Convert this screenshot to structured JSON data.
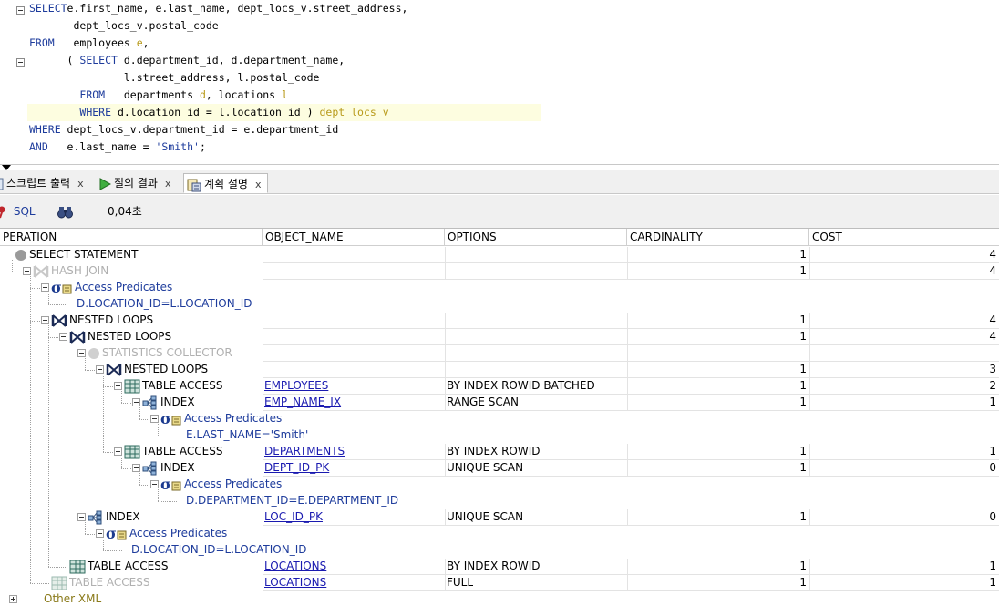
{
  "editor": {
    "lines": [
      {
        "segments": [
          [
            "kw",
            "SELECT"
          ],
          [
            "",
            "e.first_name, e.last_name, dept_locs_v.street_address,"
          ]
        ]
      },
      {
        "segments": [
          [
            "",
            "       dept_locs_v.postal_code"
          ]
        ]
      },
      {
        "segments": [
          [
            "kw",
            "FROM"
          ],
          [
            "",
            "   employees "
          ],
          [
            "al",
            "e"
          ],
          [
            "",
            ","
          ]
        ]
      },
      {
        "segments": [
          [
            "",
            "      ( "
          ],
          [
            "kw",
            "SELECT"
          ],
          [
            "",
            " d.department_id, d.department_name,"
          ]
        ]
      },
      {
        "segments": [
          [
            "",
            "               l.street_address, l.postal_code"
          ]
        ]
      },
      {
        "segments": [
          [
            "",
            "        "
          ],
          [
            "kw",
            "FROM"
          ],
          [
            "",
            "   departments "
          ],
          [
            "al",
            "d"
          ],
          [
            "",
            ", locations "
          ],
          [
            "al",
            "l"
          ]
        ]
      },
      {
        "segments": [
          [
            "",
            "        "
          ],
          [
            "kw",
            "WHERE"
          ],
          [
            "",
            " d.location_id = l.location_id ) "
          ],
          [
            "al",
            "dept_locs_v"
          ]
        ]
      },
      {
        "segments": [
          [
            "kw",
            "WHERE"
          ],
          [
            "",
            " dept_locs_v.department_id = e.department_id"
          ]
        ]
      },
      {
        "segments": [
          [
            "kw",
            "AND"
          ],
          [
            "",
            "   e.last_name = "
          ],
          [
            "str",
            "'Smith'"
          ],
          [
            "",
            ";"
          ]
        ]
      }
    ]
  },
  "tabs": [
    {
      "label": "스크립트 출력",
      "close": "x"
    },
    {
      "label": "질의 결과",
      "close": "x"
    },
    {
      "label": "계획 설명",
      "close": "x"
    }
  ],
  "toolbar": {
    "sql_label": "SQL",
    "elapsed": "0,04초"
  },
  "grid": {
    "columns": [
      "PERATION",
      "OBJECT_NAME",
      "OPTIONS",
      "CARDINALITY",
      "COST"
    ],
    "rows": [
      {
        "operation": "SELECT STATEMENT",
        "kind": "stmt",
        "style": "",
        "object": "",
        "options": "",
        "cardinality": "1",
        "cost": "4"
      },
      {
        "operation": "HASH JOIN",
        "kind": "join",
        "style": "dim",
        "object": "",
        "options": "",
        "cardinality": "1",
        "cost": "4"
      },
      {
        "operation": "Access Predicates",
        "kind": "filter",
        "style": "pred"
      },
      {
        "operation": "D.LOCATION_ID=L.LOCATION_ID",
        "kind": "none",
        "style": "pred"
      },
      {
        "operation": "NESTED LOOPS",
        "kind": "join",
        "style": "",
        "object": "",
        "options": "",
        "cardinality": "1",
        "cost": "4"
      },
      {
        "operation": "NESTED LOOPS",
        "kind": "join",
        "style": "",
        "object": "",
        "options": "",
        "cardinality": "1",
        "cost": "4"
      },
      {
        "operation": "STATISTICS COLLECTOR",
        "kind": "stmt",
        "style": "dim",
        "object": "",
        "options": "",
        "cardinality": "",
        "cost": ""
      },
      {
        "operation": "NESTED LOOPS",
        "kind": "join",
        "style": "",
        "object": "",
        "options": "",
        "cardinality": "1",
        "cost": "3"
      },
      {
        "operation": "TABLE ACCESS",
        "kind": "table",
        "style": "",
        "object": "EMPLOYEES",
        "options": "BY INDEX ROWID BATCHED",
        "cardinality": "1",
        "cost": "2"
      },
      {
        "operation": "INDEX",
        "kind": "index",
        "style": "",
        "object": "EMP_NAME_IX",
        "options": "RANGE SCAN",
        "cardinality": "1",
        "cost": "1"
      },
      {
        "operation": "Access Predicates",
        "kind": "filter",
        "style": "pred"
      },
      {
        "operation": "E.LAST_NAME='Smith'",
        "kind": "none",
        "style": "pred"
      },
      {
        "operation": "TABLE ACCESS",
        "kind": "table",
        "style": "",
        "object": "DEPARTMENTS",
        "options": "BY INDEX ROWID",
        "cardinality": "1",
        "cost": "1"
      },
      {
        "operation": "INDEX",
        "kind": "index",
        "style": "",
        "object": "DEPT_ID_PK",
        "options": "UNIQUE SCAN",
        "cardinality": "1",
        "cost": "0"
      },
      {
        "operation": "Access Predicates",
        "kind": "filter",
        "style": "pred"
      },
      {
        "operation": "D.DEPARTMENT_ID=E.DEPARTMENT_ID",
        "kind": "none",
        "style": "pred"
      },
      {
        "operation": "INDEX",
        "kind": "index",
        "style": "",
        "object": "LOC_ID_PK",
        "options": "UNIQUE SCAN",
        "cardinality": "1",
        "cost": "0"
      },
      {
        "operation": "Access Predicates",
        "kind": "filter",
        "style": "pred"
      },
      {
        "operation": "D.LOCATION_ID=L.LOCATION_ID",
        "kind": "none",
        "style": "pred"
      },
      {
        "operation": "TABLE ACCESS",
        "kind": "table",
        "style": "",
        "object": "LOCATIONS",
        "options": "BY INDEX ROWID",
        "cardinality": "1",
        "cost": "1"
      },
      {
        "operation": "TABLE ACCESS",
        "kind": "table",
        "style": "dim",
        "object": "LOCATIONS",
        "options": "FULL",
        "cardinality": "1",
        "cost": "1"
      },
      {
        "operation": "Other XML",
        "kind": "none",
        "style": "xml"
      }
    ]
  },
  "colors": {
    "keyword": "#1e3c9c",
    "alias": "#b89a1a",
    "link": "#1a1ab0",
    "dimmed": "#b0b0b0",
    "current_line": "#fdfde0"
  }
}
